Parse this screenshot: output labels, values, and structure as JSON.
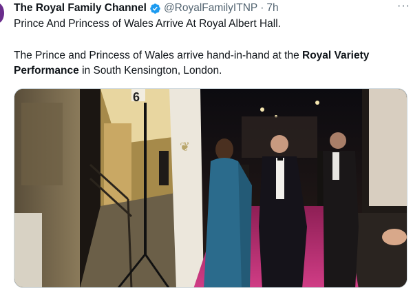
{
  "tweet": {
    "author_name": "The Royal Family Channel",
    "handle": "@RoyalFamilyITNP",
    "separator": "·",
    "time": "7h",
    "headline": "Prince And Princess of Wales Arrive At Royal Albert Hall.",
    "body_pre": "The Prince and Princess of Wales arrive hand-in-hand at the ",
    "body_bold": "Royal Variety Performance",
    "body_post": " in South Kensington, London.",
    "more_label": "···"
  },
  "media": {
    "sign_number": "6"
  },
  "colors": {
    "verified": "#1d9bf0",
    "carpet": "#c8327a",
    "text_secondary": "#536471"
  },
  "icons": {
    "verified": "verified-badge-icon",
    "more": "more-horizontal-icon"
  }
}
